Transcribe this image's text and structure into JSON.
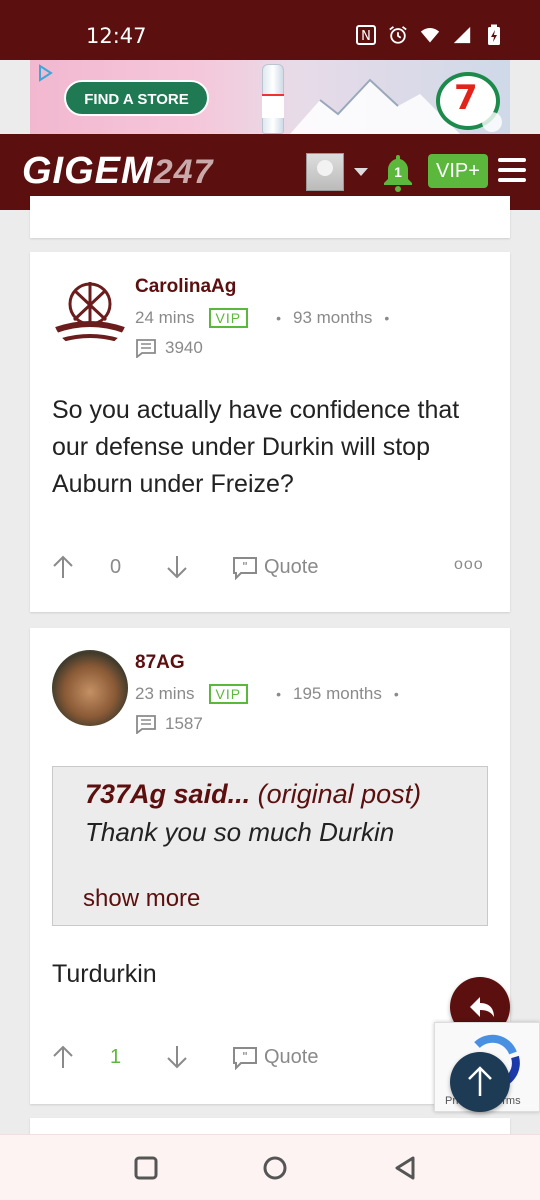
{
  "status_bar": {
    "time": "12:47"
  },
  "ad": {
    "button_label": "FIND A STORE",
    "brand_badge": "7"
  },
  "header": {
    "logo_main": "GIGEM",
    "logo_num": "247",
    "notification_count": "1",
    "vip_label": "VIP+"
  },
  "posts": [
    {
      "username": "CarolinaAg",
      "time": "24 mins",
      "badge": "VIP",
      "tenure": "93 months",
      "post_count": "3940",
      "body": "So you actually have confidence that our defense under Durkin will stop Auburn under Freize?",
      "score": "0",
      "quote_label": "Quote",
      "more_label": "ooo"
    },
    {
      "username": "87AG",
      "time": "23 mins",
      "badge": "VIP",
      "tenure": "195 months",
      "post_count": "1587",
      "quote": {
        "author": "737Ag said...",
        "original": "(original post)",
        "text": "Thank you so much Durkin",
        "show_more": "show more"
      },
      "body": "Turdurkin",
      "score": "1",
      "score_color": "#5cb83c",
      "quote_label": "Quote"
    }
  ],
  "recaptcha": {
    "text": "Privacy - Terms"
  },
  "colors": {
    "maroon": "#5c0f0f",
    "vip_green": "#5cb83c",
    "fab_blue": "#1d3b55"
  }
}
